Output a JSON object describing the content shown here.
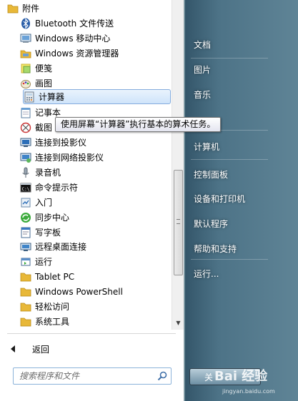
{
  "programs": [
    {
      "label": "附件",
      "icon": "folder-icon"
    },
    {
      "label": "Bluetooth 文件传送",
      "icon": "bluetooth-icon"
    },
    {
      "label": "Windows 移动中心",
      "icon": "mobility-center-icon"
    },
    {
      "label": "Windows 资源管理器",
      "icon": "explorer-icon"
    },
    {
      "label": "便笺",
      "icon": "sticky-notes-icon"
    },
    {
      "label": "画图",
      "icon": "paint-icon"
    },
    {
      "label": "计算器",
      "icon": "calculator-icon",
      "selected": true
    },
    {
      "label": "记事本",
      "icon": "notepad-icon"
    },
    {
      "label": "截图",
      "icon": "snipping-tool-icon"
    },
    {
      "label": "连接到投影仪",
      "icon": "projector-icon"
    },
    {
      "label": "连接到网络投影仪",
      "icon": "network-projector-icon"
    },
    {
      "label": "录音机",
      "icon": "microphone-icon"
    },
    {
      "label": "命令提示符",
      "icon": "command-prompt-icon"
    },
    {
      "label": "入门",
      "icon": "getting-started-icon"
    },
    {
      "label": "同步中心",
      "icon": "sync-center-icon"
    },
    {
      "label": "写字板",
      "icon": "wordpad-icon"
    },
    {
      "label": "远程桌面连接",
      "icon": "remote-desktop-icon"
    },
    {
      "label": "运行",
      "icon": "run-icon"
    },
    {
      "label": "Tablet PC",
      "icon": "folder-icon"
    },
    {
      "label": "Windows PowerShell",
      "icon": "folder-icon"
    },
    {
      "label": "轻松访问",
      "icon": "folder-icon"
    },
    {
      "label": "系统工具",
      "icon": "folder-icon"
    }
  ],
  "back_label": "返回",
  "search": {
    "placeholder": "搜索程序和文件"
  },
  "tooltip": "使用屏幕“计算器”执行基本的算术任务。",
  "right_menu": [
    "文档",
    "图片",
    "音乐",
    "计算机",
    "控制面板",
    "设备和打印机",
    "默认程序",
    "帮助和支持",
    "运行..."
  ],
  "shutdown_label": "关",
  "watermark": {
    "brand": "Bai 经验",
    "url": "jingyan.baidu.com"
  },
  "colors": {
    "selection_border": "#84acdd",
    "right_pane": "#4d7387",
    "folder": "#e8b838"
  }
}
